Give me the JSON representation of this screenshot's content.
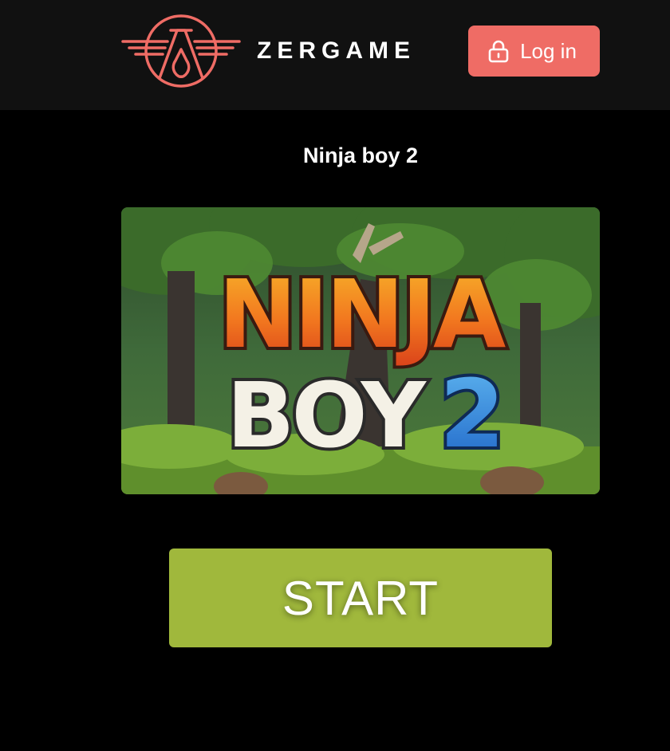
{
  "header": {
    "brand": "ZERGAME",
    "login_label": "Log in",
    "icons": {
      "logo": "zergame-emblem-icon",
      "login": "lock-icon"
    }
  },
  "game": {
    "title": "Ninja boy 2",
    "cover": {
      "line1": "NINJA",
      "line2": "BOY",
      "number": "2"
    },
    "start_label": "START"
  },
  "colors": {
    "header_bg": "#111111",
    "page_bg": "#000000",
    "accent": "#ef6c65",
    "start_button": "#a0b83c"
  }
}
